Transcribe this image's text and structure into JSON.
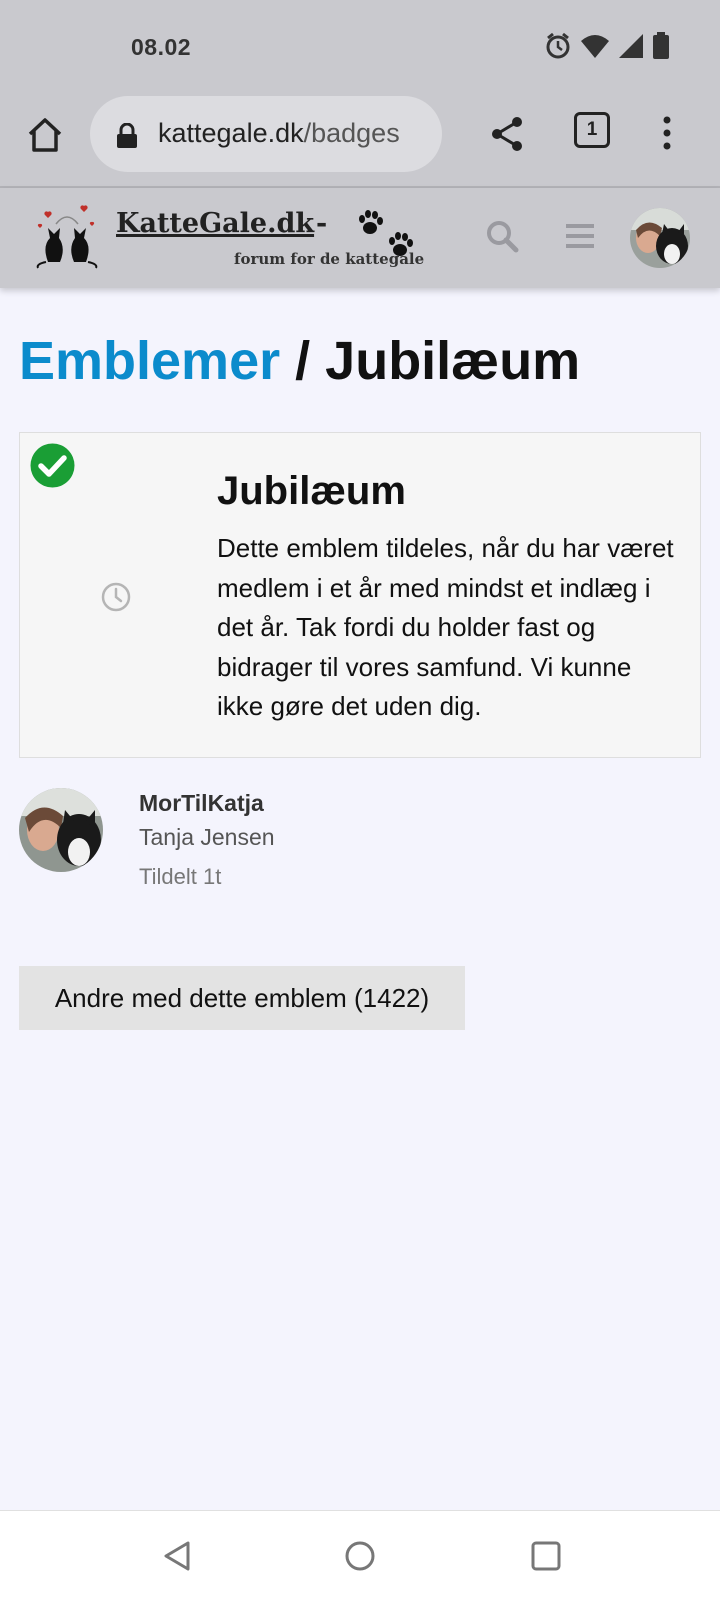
{
  "status_bar": {
    "time": "08.02",
    "icons": [
      "alarm-icon",
      "wifi-icon",
      "signal-icon",
      "battery-icon"
    ]
  },
  "browser": {
    "url_domain": "kattegale.dk",
    "url_path": "/badges",
    "tab_count": "1"
  },
  "site_header": {
    "logo_title": "KatteGale.dk",
    "logo_dash": "-",
    "logo_subtitle": "forum for de kattegale"
  },
  "page": {
    "breadcrumb_link": "Emblemer",
    "separator": "/",
    "title": "Jubilæum"
  },
  "badge": {
    "name": "Jubilæum",
    "description": "Dette emblem tildeles, når du har været medlem i et år med mindst et indlæg i det år. Tak fordi du holder fast og bidrager til vores samfund. Vi kunne ikke gøre det uden dig.",
    "granted": true,
    "icon": "clock-icon"
  },
  "user": {
    "username": "MorTilKatja",
    "full_name": "Tanja Jensen",
    "granted_text": "Tildelt 1t"
  },
  "others_button": "Andre med dette emblem (1422)",
  "colors": {
    "accent": "#0b8bcc",
    "check": "#1a9e35",
    "header_bg": "#c9c9ce",
    "page_bg": "#f4f4fd"
  }
}
